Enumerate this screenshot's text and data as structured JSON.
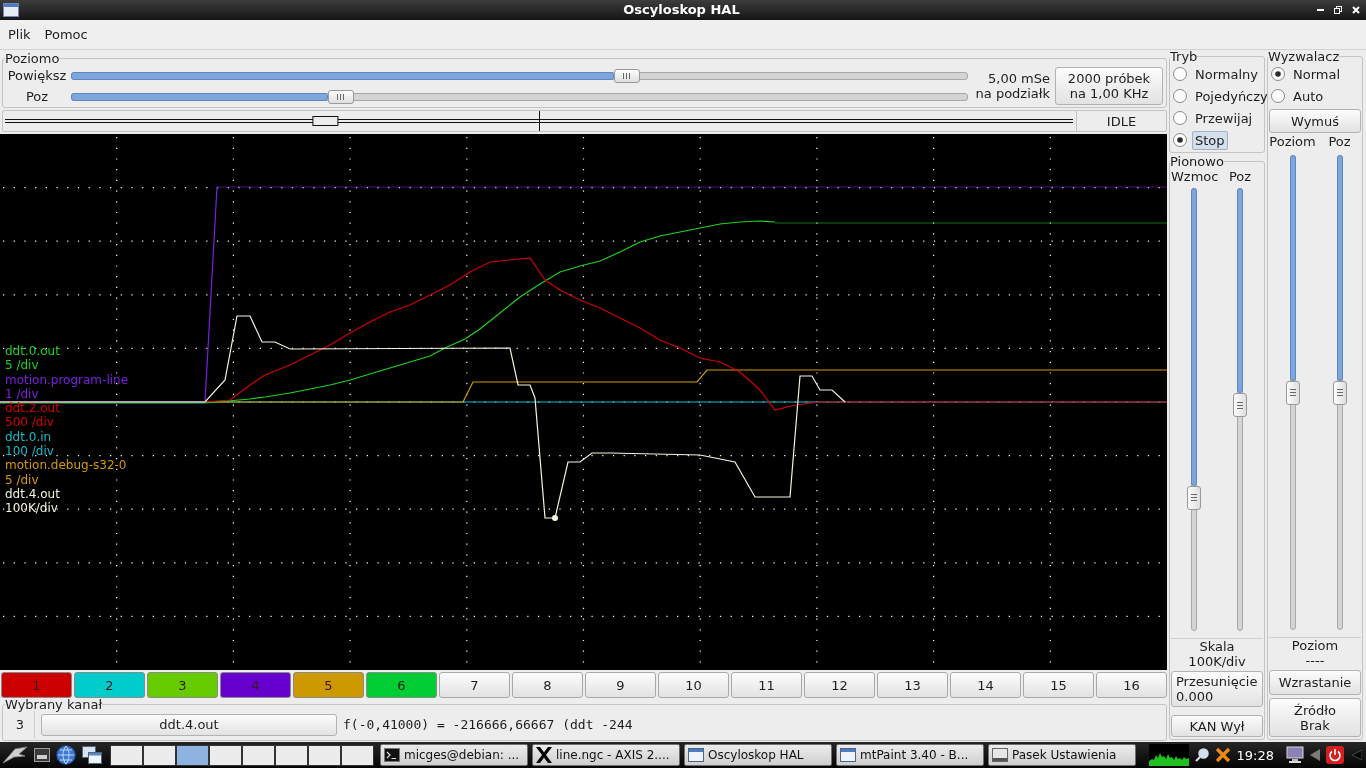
{
  "window": {
    "title": "Oscyloskop HAL"
  },
  "menu": [
    "Plik",
    "Pomoc"
  ],
  "horizontal": {
    "title": "Poziomo",
    "sliders": [
      {
        "label": "Powiększ",
        "level": 0.62
      },
      {
        "label": "Poz",
        "level": 0.3
      }
    ],
    "scale": [
      "5,00 mSe",
      "na podziałk"
    ],
    "samples_button": [
      "2000 próbek",
      "na 1,00 KHz"
    ],
    "status": "IDLE"
  },
  "scope": {
    "traces": [
      {
        "name": "ddt.0.out",
        "scale": "5 /div",
        "color": "#1ed21e"
      },
      {
        "name": "motion.program-line",
        "scale": "1 /div",
        "color": "#7a1fe0"
      },
      {
        "name": "ddt.2.out",
        "scale": "500 /div",
        "color": "#d40000"
      },
      {
        "name": "ddt.0.in",
        "scale": "100 /div",
        "color": "#16bcc8"
      },
      {
        "name": "motion.debug-s32-0",
        "scale": "5 /div",
        "color": "#d49a0a"
      },
      {
        "name": "ddt.4.out",
        "scale": "100K/div",
        "color": "#f4f4dc"
      }
    ]
  },
  "channels": [
    {
      "label": "1",
      "color": "#cc0000"
    },
    {
      "label": "2",
      "color": "#00cccc"
    },
    {
      "label": "3",
      "color": "#66cc00"
    },
    {
      "label": "4",
      "color": "#6600cc"
    },
    {
      "label": "5",
      "color": "#cc9900"
    },
    {
      "label": "6",
      "color": "#00cc33"
    },
    {
      "label": "7"
    },
    {
      "label": "8"
    },
    {
      "label": "9"
    },
    {
      "label": "10"
    },
    {
      "label": "11"
    },
    {
      "label": "12"
    },
    {
      "label": "13"
    },
    {
      "label": "14"
    },
    {
      "label": "15"
    },
    {
      "label": "16"
    }
  ],
  "selected_channel": {
    "title": "Wybrany kanał",
    "number": "3",
    "name": "ddt.4.out",
    "readout": "f(-0,41000) = -216666,66667 (ddt -244"
  },
  "mode": {
    "title": "Tryb",
    "options": [
      {
        "label": "Normalny",
        "selected": false,
        "focused": false
      },
      {
        "label": "Pojedyńczy",
        "selected": false,
        "focused": false
      },
      {
        "label": "Przewijaj",
        "selected": false,
        "focused": false
      },
      {
        "label": "Stop",
        "selected": true,
        "focused": true
      }
    ]
  },
  "vertical": {
    "title": "Pionowo",
    "sliders": [
      {
        "label": "Wzmoc",
        "level": 0.7
      },
      {
        "label": "Poz",
        "level": 0.49
      }
    ],
    "scale_label": "Skala",
    "scale_value": "100K/div",
    "offset_button": [
      "Przesunięcie",
      "0.000"
    ],
    "off_button": "KAN Wył"
  },
  "trigger": {
    "title": "Wyzwalacz",
    "options": [
      {
        "label": "Normal",
        "selected": true,
        "focused": false
      },
      {
        "label": "Auto",
        "selected": false,
        "focused": false
      }
    ],
    "force_button": "Wymuś",
    "sliders": [
      {
        "label": "Poziom",
        "level": 0.5
      },
      {
        "label": "Poz",
        "level": 0.5
      }
    ],
    "level_label": "Poziom",
    "level_value": "----",
    "edge_button": "Wzrastanie",
    "source_button": [
      "Źródło",
      "Brak"
    ]
  },
  "taskbar": {
    "desktops": [
      {
        "selected": false
      },
      {
        "selected": false
      },
      {
        "selected": true
      },
      {
        "selected": false
      },
      {
        "selected": false
      },
      {
        "selected": false
      },
      {
        "selected": false
      },
      {
        "selected": false
      }
    ],
    "tasks": [
      {
        "label": "micges@debian: ...",
        "kind": "terminal"
      },
      {
        "label": "line.ngc - AXIS 2....",
        "kind": "xlogo"
      },
      {
        "label": "Oscyloskop HAL",
        "kind": "window"
      },
      {
        "label": "mtPaint 3.40 - B...",
        "kind": "window"
      },
      {
        "label": "Pasek Ustawienia",
        "kind": "panel"
      }
    ],
    "clock": "19:28"
  }
}
